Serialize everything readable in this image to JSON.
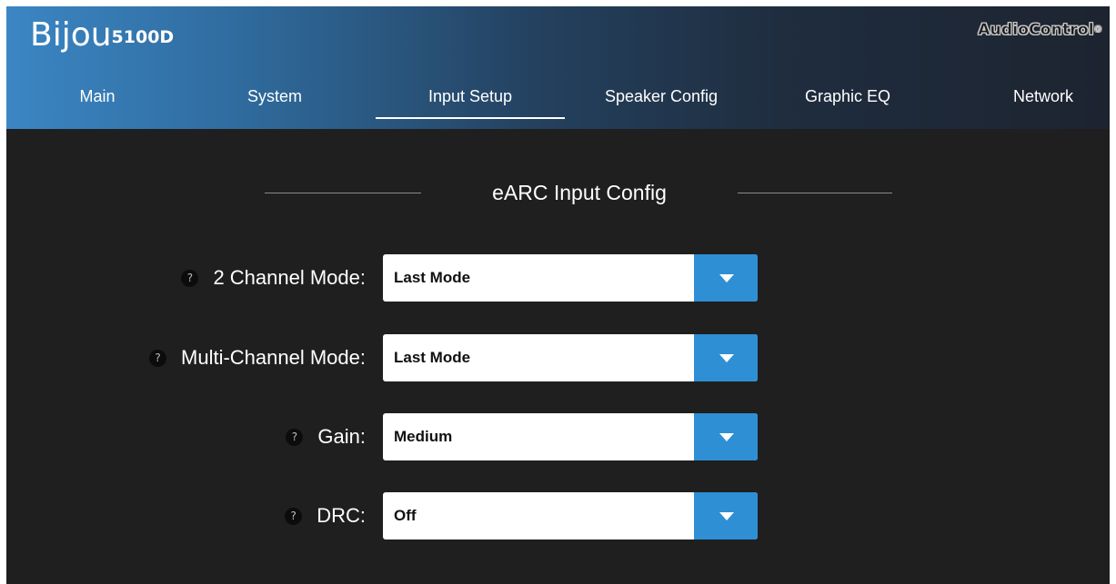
{
  "brand": {
    "name": "Bijou",
    "model": "5100D",
    "logo": "AudioControl",
    "logo_mark": "®"
  },
  "colors": {
    "accent": "#2e8fd4",
    "background": "#1f1f1f",
    "header_start": "#3b86c4",
    "header_end": "#1d2430"
  },
  "nav": {
    "tabs": [
      {
        "label": "Main"
      },
      {
        "label": "System"
      },
      {
        "label": "Input Setup",
        "active": true
      },
      {
        "label": "Speaker Config"
      },
      {
        "label": "Graphic EQ"
      },
      {
        "label": "Network"
      }
    ]
  },
  "section": {
    "title": "eARC Input Config",
    "fields": [
      {
        "help": "?",
        "label": "2 Channel Mode:",
        "value": "Last Mode",
        "icon": "chevron-down-icon"
      },
      {
        "help": "?",
        "label": "Multi-Channel Mode:",
        "value": "Last Mode",
        "icon": "chevron-down-icon"
      },
      {
        "help": "?",
        "label": "Gain:",
        "value": "Medium",
        "icon": "chevron-down-icon"
      },
      {
        "help": "?",
        "label": "DRC:",
        "value": "Off",
        "icon": "chevron-down-icon"
      }
    ]
  }
}
